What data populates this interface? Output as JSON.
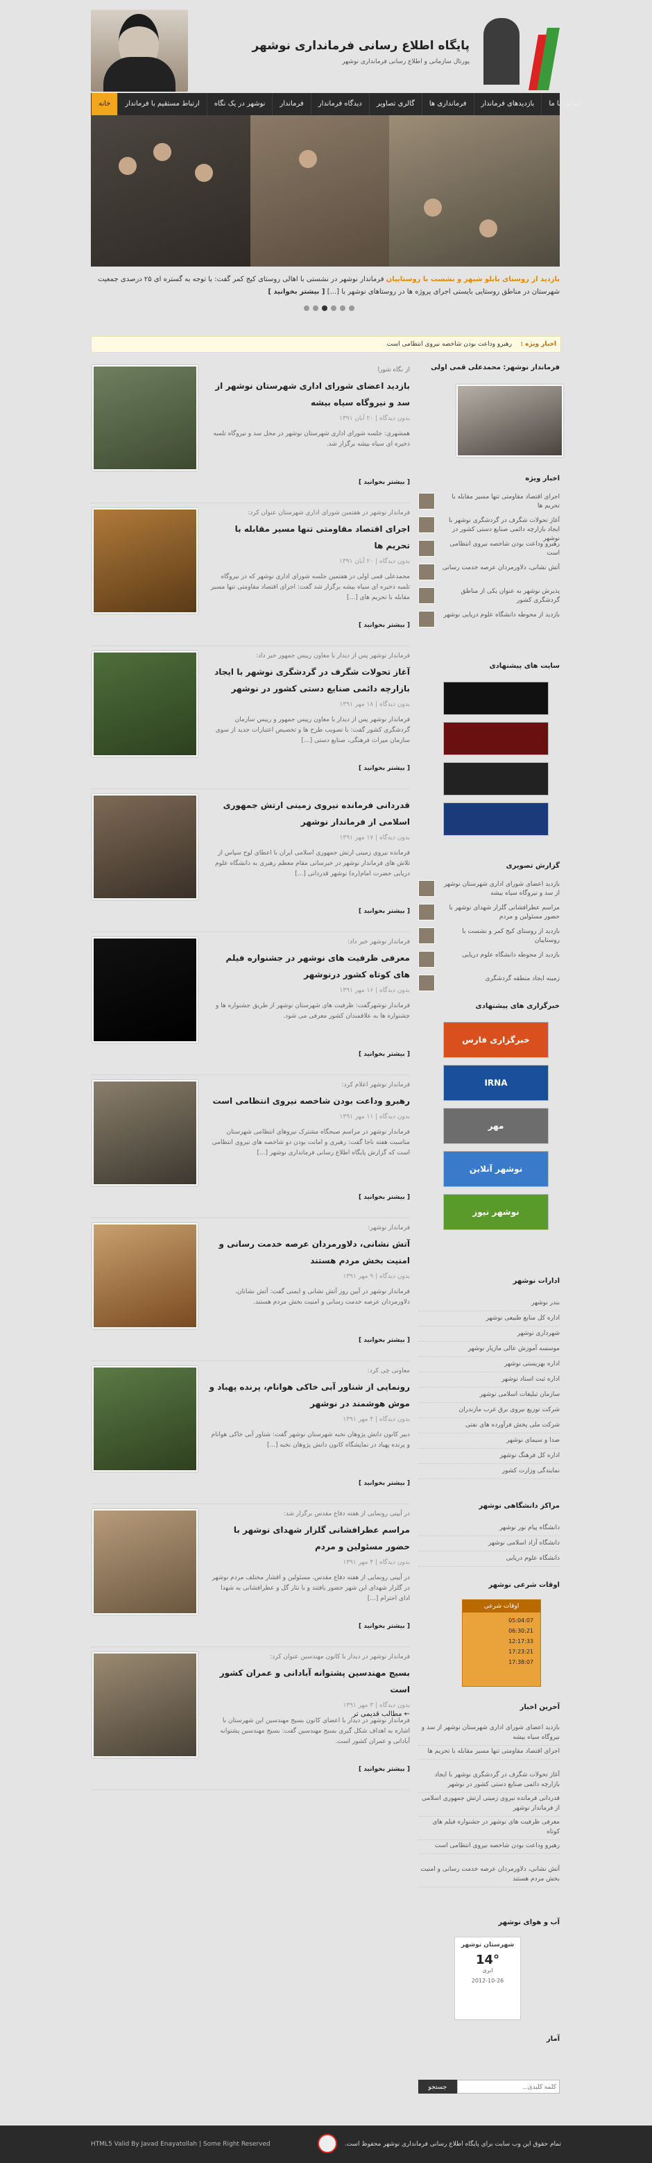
{
  "header": {
    "site_title": "پایگاه اطلاع رسانی فرمانداری نوشهر",
    "site_subtitle": "پورتال سازمانی و اطلاع رسانی فرمانداری نوشهر"
  },
  "nav": {
    "items": [
      "خانه",
      "ارتباط مستقیم با فرماندار",
      "نوشهر در یک نگاه",
      "فرماندار",
      "دیدگاه فرماندار",
      "گالری تصاویر",
      "فرمانداری ها",
      "بازدیدهای فرماندار",
      "تماس با ما"
    ]
  },
  "slider": {
    "caption_highlight": "بازدید از روستای بابلو شبهر و نشست با روستاییان",
    "caption_text": "فرماندار نوشهر در نشستی با اهالی روستای کیج کمر گفت: با توجه به گستره ای ۲۵ درصدی جمعیت شهرستان در مناطق روستایی بایستی اجرای پروژه ها در روستاهای نوشهر با [...]",
    "caption_more": "[ بیشتر بخوانید ]",
    "dots": 6,
    "active_dot": 2
  },
  "ticker": {
    "label": "اخبار ویژه :",
    "text": "رهبرو وداعت بودن شاخصه نیروی انتظامی است"
  },
  "posts": [
    {
      "kicker": "از نگاه شورا",
      "title": "بازدید اعضای شورای اداری شهرستان نوشهر از سد و نیروگاه سیاه بیشه",
      "meta": "بدون دیدگاه | ۲۰ آبان ۱۳۹۱",
      "excerpt": "همشهری: جلسه شورای اداری شهرستان نوشهر در محل سد و نیروگاه تلمبه ذخیره ای سیاه بیشه برگزار شد.",
      "more": "[ بیشتر بخوانید ]"
    },
    {
      "kicker": "فرماندار نوشهر در هفتمین شورای اداری شهرستان عنوان کرد:",
      "title": "اجرای اقتصاد مقاومتی تنها مسیر مقابله با تحریم ها",
      "meta": "بدون دیدگاه | ۲۰ آبان ۱۳۹۱",
      "excerpt": "محمدعلی قمی اولی در هفتمین جلسه شورای اداری نوشهر که در نیروگاه تلمبه ذخیره ای سیاه بیشه برگزار شد گفت: اجرای اقتصاد مقاومتی تنها مسیر مقابله با تحریم های [...]",
      "more": "[ بیشتر بخوانید ]"
    },
    {
      "kicker": "فرماندار نوشهر پس از دیدار با معاون رییس جمهور خبر داد:",
      "title": "آغاز تحولات شگرف در گردشگری نوشهر با ایجاد بازارچه دائمی صنایع دستی کشور در نوشهر",
      "meta": "بدون دیدگاه | ۱۸ مهر ۱۳۹۱",
      "excerpt": "فرماندار نوشهر پس از دیدار با معاون رییس جمهور و رییس سازمان گردشگری کشور گفت: با تصویب طرح ها و تخصیص اعتبارات جدید از سوی سازمان میراث فرهنگی، صنایع دستی [...]",
      "more": "[ بیشتر بخوانید ]"
    },
    {
      "kicker": "",
      "title": "قدردانی فرمانده نیروی زمینی ارتش جمهوری اسلامی از فرماندار نوشهر",
      "meta": "بدون دیدگاه | ۱۷ مهر ۱۳۹۱",
      "excerpt": "فرمانده نیروی زمینی ارتش جمهوری اسلامی ایران با اعطای لوح سپاس از تلاش های فرماندار نوشهر در خبرسانی مقام معظم رهبری به دانشگاه علوم دریایی حضرت امام(ره) نوشهر قدردانی [...]",
      "more": "[ بیشتر بخوانید ]"
    },
    {
      "kicker": "فرماندار نوشهر خبر داد:",
      "title": "معرفی ظرفیت های نوشهر در جشنواره فیلم های کوتاه کشور درنوشهر",
      "meta": "بدون دیدگاه | ۱۶ مهر ۱۳۹۱",
      "excerpt": "فرماندار نوشهرگفت: ظرفیت های شهرستان نوشهر از طریق جشنواره ها و جشنواره ها به علاقمندان کشور معرفی می شود.",
      "more": "[ بیشتر بخوانید ]"
    },
    {
      "kicker": "فرماندار نوشهر اعلام کرد:",
      "title": "رهبرو وداعت بودن شاخصه نیروی انتظامی است",
      "meta": "بدون دیدگاه | ۱۱ مهر ۱۳۹۱",
      "excerpt": "فرماندار نوشهر در مراسم صبحگاه مشترک نیروهای انتظامی شهرستان مناسبت هفته ناجا گفت: رهبری و امانت بودن دو شاخصه های نیروی انتظامی است که گزارش پایگاه اطلاع رسانی فرمانداری نوشهر [...]",
      "more": "[ بیشتر بخوانید ]"
    },
    {
      "kicker": "فرماندار نوشهر:",
      "title": "آتش نشانی، دلاورمردان عرصه خدمت رسانی و امنیت بخش مردم هستند",
      "meta": "بدون دیدگاه | ۹ مهر ۱۳۹۱",
      "excerpt": "فرماندار نوشهر در آیین روز آتش نشانی و ایمنی گفت: آتش نشانان، دلاورمردان عرصه خدمت رسانی و امنیت بخش مردم هستند.",
      "more": "[ بیشتر بخوانید ]"
    },
    {
      "kicker": "معاونی چی کرد:",
      "title": "رونمایی از شناور آبی خاکی هوانام، پرنده پهباد و موش هوشمند در نوشهر",
      "meta": "بدون دیدگاه | ۴ مهر ۱۳۹۱",
      "excerpt": "دبیر کانون دانش پژوهان نخبه شهرستان نوشهر گفت: شناور آبی خاکی هوانام و پرنده پهباد در نمایشگاه کانون دانش پژوهان نخبه [...]",
      "more": "[ بیشتر بخوانید ]"
    },
    {
      "kicker": "در آیینی رونمایی از هفته دفاع مقدس برگزار شد:",
      "title": "مراسم عطرافشانی گلزار شهدای نوشهر با حضور مسئولین و مردم",
      "meta": "بدون دیدگاه | ۴ مهر ۱۳۹۱",
      "excerpt": "در آیینی رونمایی از هفته دفاع مقدس، مسئولین و اقشار مختلف مردم نوشهر در گلزار شهدای این شهر حضور یافتند و با نثار گل و عطرافشانی به شهدا ادای احترام [...]",
      "more": "[ بیشتر بخوانید ]"
    },
    {
      "kicker": "فرماندار نوشهر در دیدار با کانون مهندسین عنوان کرد:",
      "title": "بسیج مهندسین پشتوانه آبادانی و عمران کشور است",
      "meta": "بدون دیدگاه | ۳ مهر ۱۳۹۱",
      "excerpt": "فرماندار نوشهر در دیدار با اعضای کانون بسیج مهندسین این شهرستان با اشاره به اهداف شکل گیری بسیج مهندسین گفت: بسیج مهندسین پشتوانه آبادانی و عمران کشور است.",
      "more": "[ بیشتر بخوانید ]"
    }
  ],
  "older_posts": "← مطالب قدیمی تر",
  "sidebar": {
    "gov_title": "فرماندار نوشهر: محمدعلی قمی اولی",
    "special_title": "اخبار ویژه",
    "special_items": [
      "اجرای اقتصاد مقاومتی تنها مسیر مقابله با تحریم ها",
      "آغاز تحولات شگرف در گردشگری نوشهر با ایجاد بازارچه دائمی صنایع دستی کشور در نوشهر",
      "رهبرو وداعت بودن شاخصه نیروی انتظامی است",
      "آتش نشانی، دلاورمردان عرصه خدمت رسانی",
      "پذیرش نوشهر به عنوان یکی از مناطق گردشگری کشور",
      "بازدید از محوطه دانشگاه علوم دریایی نوشهر"
    ],
    "sites_title": "سایت های پیشنهادی",
    "news_title": "گزارش تصویری",
    "news_items": [
      "بازدید اعضای شورای اداری شهرستان نوشهر از سد و نیروگاه سیاه بیشه",
      "مراسم عطرافشانی گلزار شهدای نوشهر با حضور مسئولین و مردم",
      "بازدید از روستای کیج کمر و نشست با روستاییان",
      "بازدید از محوطه دانشگاه علوم دریایی",
      "زمینه ایجاد منطقه گردشگری"
    ],
    "agencies_title": "خبرگزاری های پیشنهادی",
    "agencies": [
      "خبرگزاری فارس",
      "IRNA",
      "مهر",
      "نوشهر آنلاین",
      "نوشهر نیوز"
    ],
    "depts_title": "ادارات نوشهر",
    "depts": [
      "بندر نوشهر",
      "اداره کل منابع طبیعی نوشهر",
      "شهرداری نوشهر",
      "موسسه آموزش عالی مازیار نوشهر",
      "اداره بهزیستی نوشهر",
      "اداره ثبت اسناد نوشهر",
      "سازمان تبلیغات اسلامی نوشهر",
      "شرکت توزیع نیروی برق غرب مازندران",
      "شرکت ملی پخش فرآورده های نفتی",
      "صدا و سیمای نوشهر",
      "اداره کل فرهنگ نوشهر",
      "نمایندگی وزارت کشور"
    ],
    "academic_title": "مراکز دانشگاهی نوشهر",
    "academic": [
      "دانشگاه پیام نور نوشهر",
      "دانشگاه آزاد اسلامی نوشهر",
      "دانشگاه علوم دریایی"
    ],
    "prayer_title": "اوقات شرعی نوشهر",
    "prayer_header": "اوقات شرعی",
    "prayer_rows": [
      "05:04:07",
      "06:30:21",
      "12:17:33",
      "17:23:21",
      "17:38:07"
    ],
    "latest_title": "آخرین اخبار",
    "latest": [
      "بازدید اعضای شورای اداری شهرستان نوشهر از سد و نیروگاه سیاه بیشه",
      "اجرای اقتصاد مقاومتی تنها مسیر مقابله با تحریم ها",
      "آغاز تحولات شگرف در گردشگری نوشهر با ایجاد بازارچه دائمی صنایع دستی کشور در نوشهر",
      "قدردانی فرمانده نیروی زمینی ارتش جمهوری اسلامی از فرماندار نوشهر",
      "معرفی ظرفیت های نوشهر در جشنواره فیلم های کوتاه",
      "رهبرو وداعت بودن شاخصه نیروی انتظامی است",
      "آتش نشانی، دلاورمردان عرصه خدمت رسانی و امنیت بخش مردم هستند"
    ],
    "weather_title": "آب و هوای نوشهر",
    "weather_city": "شهرستان نوشهر",
    "weather_temp": "14°",
    "weather_desc": "ابری",
    "weather_date": "2012-10-26",
    "archive_title": "آمار",
    "search_placeholder": "کلمه کلیدی...",
    "search_button": "جستجو"
  },
  "footer": {
    "right": "تمام حقوق این وب سایت برای پایگاه اطلاع رسانی فرمانداری نوشهر محفوظ است.",
    "left": "HTML5 Valid By Javad Enayatollah | Some Right Reserved"
  }
}
